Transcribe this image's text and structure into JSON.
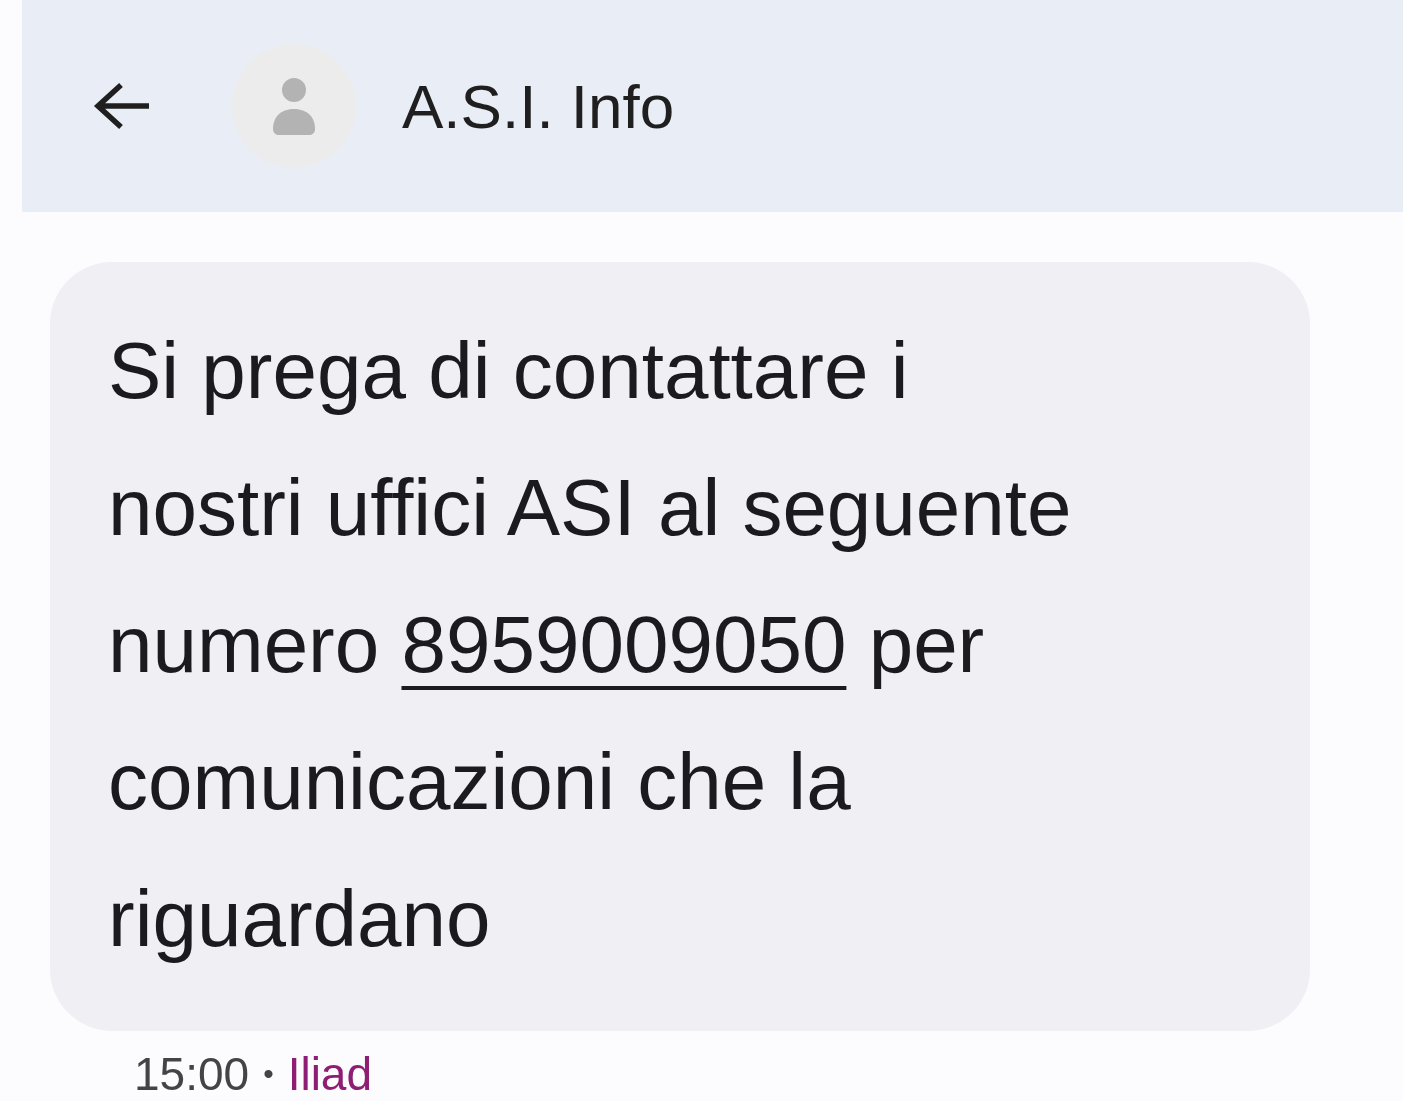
{
  "header": {
    "title": "A.S.I. Info"
  },
  "message": {
    "text_before": "Si prega di contattare i nostri uffici ASI al seguente numero ",
    "link": "8959009050",
    "text_after": " per comunicazioni che la riguardano",
    "time": "15:00",
    "separator": "•",
    "carrier": "Iliad"
  }
}
